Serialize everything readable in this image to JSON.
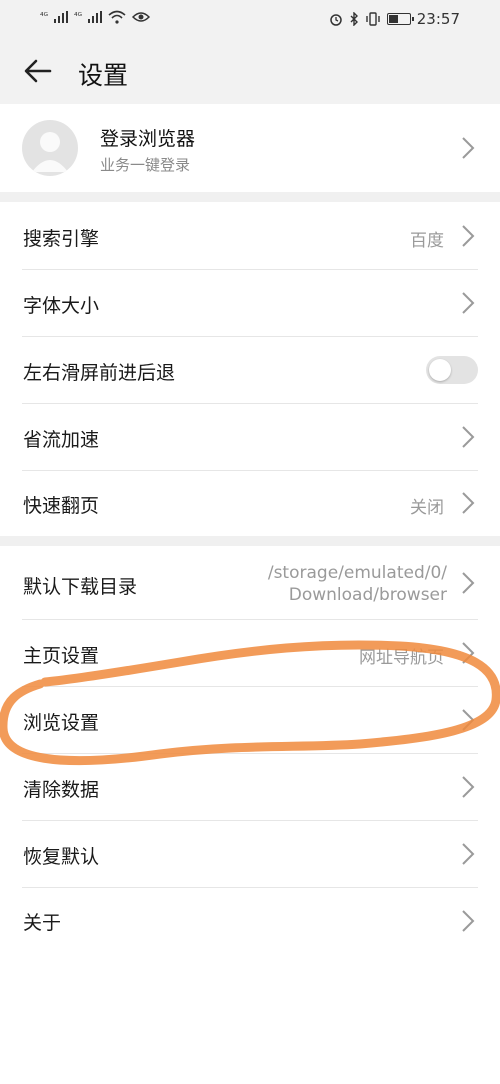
{
  "status_bar": {
    "signal_1": "⁴ᴳ",
    "signal_2": "⁴ᴳ",
    "time": "23:57",
    "battery_level": 0.45
  },
  "header": {
    "title": "设置"
  },
  "account": {
    "title": "登录浏览器",
    "subtitle": "业务一键登录"
  },
  "settings": {
    "search_engine": {
      "label": "搜索引擎",
      "value": "百度"
    },
    "font_size": {
      "label": "字体大小"
    },
    "swipe_nav": {
      "label": "左右滑屏前进后退",
      "enabled": false
    },
    "data_saver": {
      "label": "省流加速"
    },
    "quick_page": {
      "label": "快速翻页",
      "value": "关闭"
    },
    "download_dir": {
      "label": "默认下载目录",
      "value_line1": "/storage/emulated/0/",
      "value_line2": "Download/browser"
    },
    "homepage": {
      "label": "主页设置",
      "value": "网址导航页"
    },
    "browse": {
      "label": "浏览设置"
    },
    "clear_data": {
      "label": "清除数据"
    },
    "restore_default": {
      "label": "恢复默认"
    },
    "about": {
      "label": "关于"
    }
  },
  "colors": {
    "annotation": "#f08a3c",
    "background": "#f2f2f2",
    "text_secondary": "#9a9a9a"
  }
}
